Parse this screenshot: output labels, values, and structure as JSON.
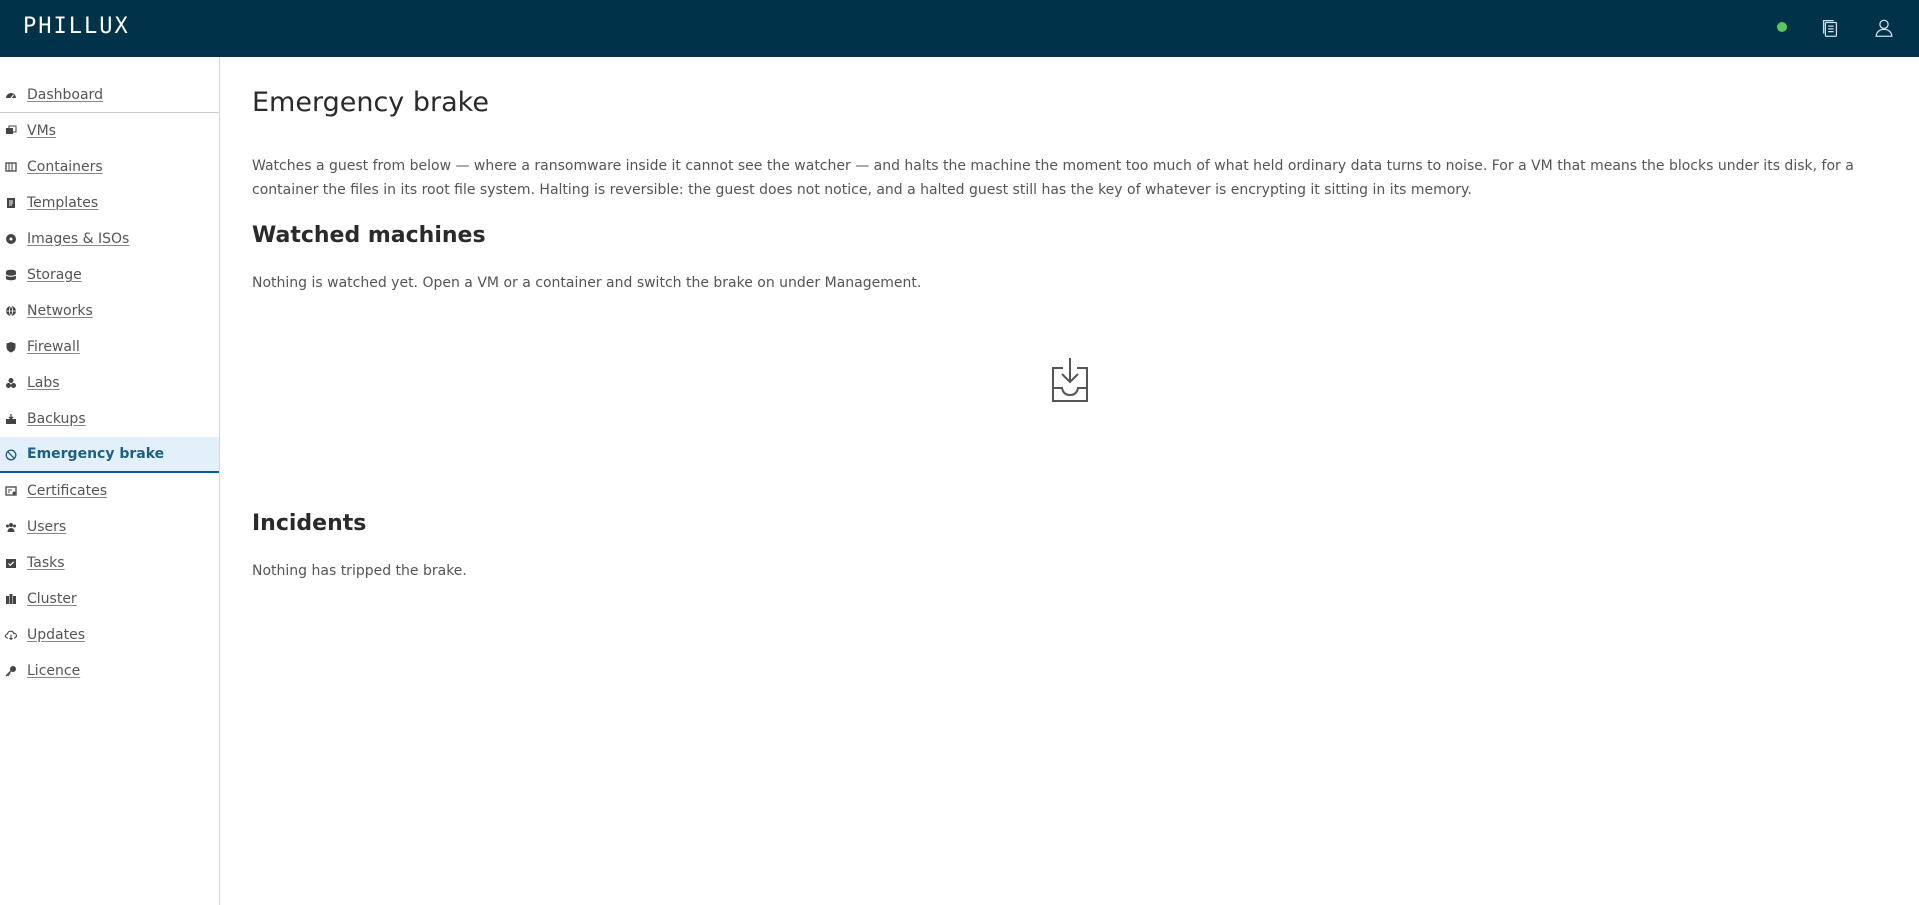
{
  "app": {
    "logo": "PHILLUX",
    "status_color": "#5ec65e",
    "header_color": "#00324a",
    "icons": {
      "copy": "documents-icon",
      "user": "user-icon"
    }
  },
  "sidebar": {
    "items": [
      {
        "label": "Dashboard",
        "icon": "dashboard-icon"
      },
      {
        "label": "VMs",
        "icon": "vms-icon"
      },
      {
        "label": "Containers",
        "icon": "containers-icon"
      },
      {
        "label": "Templates",
        "icon": "templates-icon"
      },
      {
        "label": "Images & ISOs",
        "icon": "disc-icon"
      },
      {
        "label": "Storage",
        "icon": "storage-icon"
      },
      {
        "label": "Networks",
        "icon": "globe-icon"
      },
      {
        "label": "Firewall",
        "icon": "shield-icon"
      },
      {
        "label": "Labs",
        "icon": "flask-icon"
      },
      {
        "label": "Backups",
        "icon": "backup-icon"
      },
      {
        "label": "Emergency brake",
        "icon": "ban-icon",
        "active": true
      },
      {
        "label": "Certificates",
        "icon": "certificate-icon"
      },
      {
        "label": "Users",
        "icon": "users-icon"
      },
      {
        "label": "Tasks",
        "icon": "tasks-icon"
      },
      {
        "label": "Cluster",
        "icon": "cluster-icon"
      },
      {
        "label": "Updates",
        "icon": "cloud-download-icon"
      },
      {
        "label": "Licence",
        "icon": "key-icon"
      }
    ]
  },
  "main": {
    "title": "Emergency brake",
    "description": "Watches a guest from below — where a ransomware inside it cannot see the watcher — and halts the machine the moment too much of what held ordinary data turns to noise. For a VM that means the blocks under its disk, for a container the files in its root file system. Halting is reversible: the guest does not notice, and a halted guest still has the key of whatever is encrypting it sitting in its memory.",
    "watched": {
      "title": "Watched machines",
      "empty_text": "Nothing is watched yet. Open a VM or a container and switch the brake on under Management.",
      "empty_icon": "inbox-download-icon"
    },
    "incidents": {
      "title": "Incidents",
      "empty_text": "Nothing has tripped the brake."
    }
  }
}
